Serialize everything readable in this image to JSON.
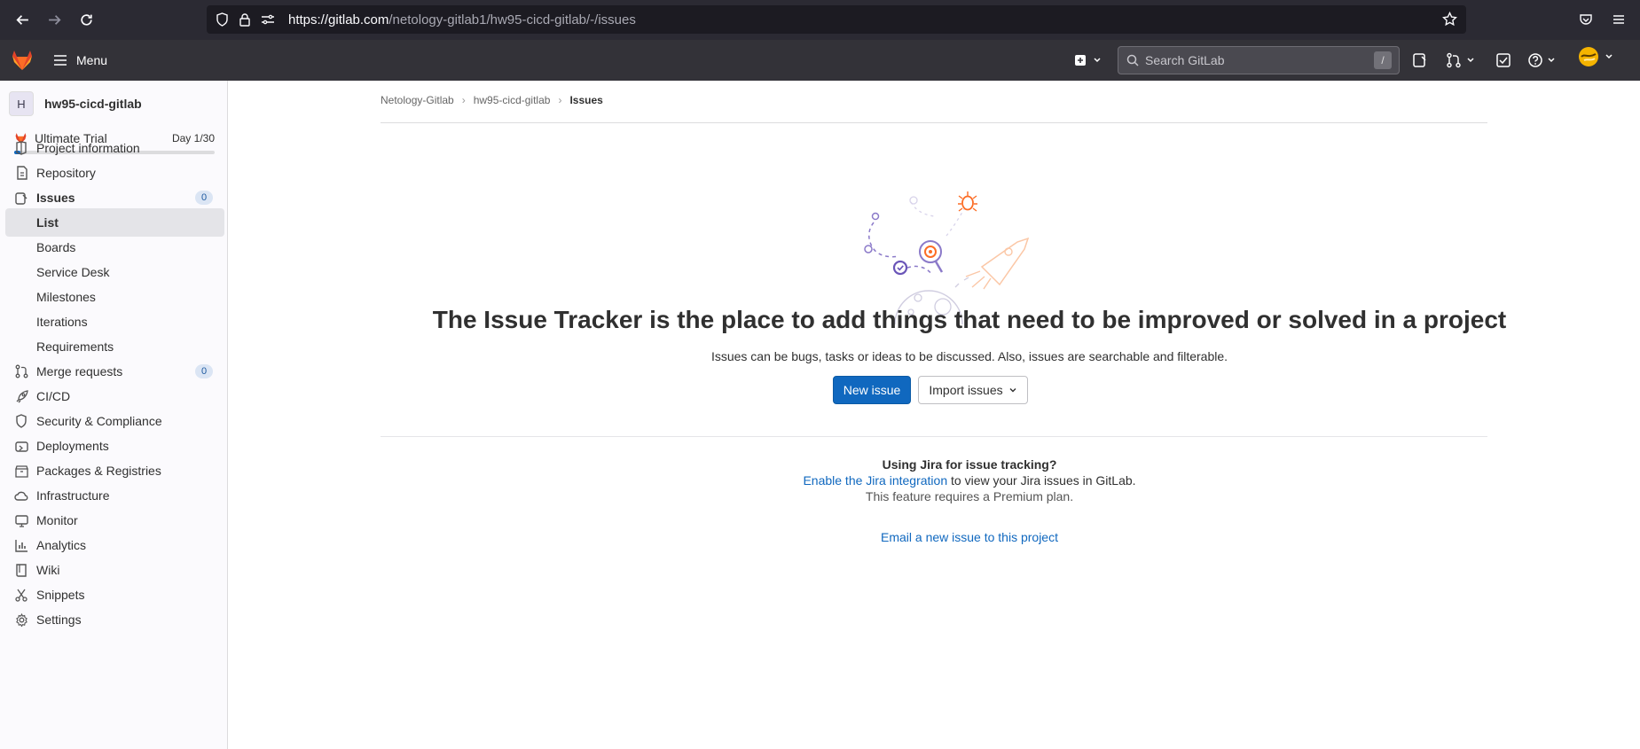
{
  "browser": {
    "url_host": "https://gitlab.com",
    "url_path": "/netology-gitlab1/hw95-cicd-gitlab/-/issues"
  },
  "header": {
    "menu_label": "Menu",
    "search_placeholder": "Search GitLab",
    "search_shortcut": "/"
  },
  "sidebar": {
    "project_avatar": "H",
    "project_name": "hw95-cicd-gitlab",
    "trial_label": "Ultimate Trial",
    "trial_day": "Day 1/30",
    "trial_progress": 0.033,
    "items": [
      {
        "label": "Project information",
        "icon": "project-info-icon"
      },
      {
        "label": "Repository",
        "icon": "repository-icon"
      },
      {
        "label": "Issues",
        "icon": "issues-icon",
        "count": "0"
      },
      {
        "label": "List"
      },
      {
        "label": "Boards"
      },
      {
        "label": "Service Desk"
      },
      {
        "label": "Milestones"
      },
      {
        "label": "Iterations"
      },
      {
        "label": "Requirements"
      },
      {
        "label": "Merge requests",
        "icon": "merge-request-icon",
        "count": "0"
      },
      {
        "label": "CI/CD",
        "icon": "rocket-icon"
      },
      {
        "label": "Security & Compliance",
        "icon": "shield-icon"
      },
      {
        "label": "Deployments",
        "icon": "deployments-icon"
      },
      {
        "label": "Packages & Registries",
        "icon": "package-icon"
      },
      {
        "label": "Infrastructure",
        "icon": "cloud-icon"
      },
      {
        "label": "Monitor",
        "icon": "monitor-icon"
      },
      {
        "label": "Analytics",
        "icon": "chart-icon"
      },
      {
        "label": "Wiki",
        "icon": "book-icon"
      },
      {
        "label": "Snippets",
        "icon": "scissors-icon"
      },
      {
        "label": "Settings",
        "icon": "gear-icon"
      }
    ]
  },
  "breadcrumb": [
    "Netology-Gitlab",
    "hw95-cicd-gitlab",
    "Issues"
  ],
  "empty_state": {
    "title": "The Issue Tracker is the place to add things that need to be improved or solved in a project",
    "description": "Issues can be bugs, tasks or ideas to be discussed. Also, issues are searchable and filterable.",
    "new_issue_label": "New issue",
    "import_issues_label": "Import issues"
  },
  "jira": {
    "heading": "Using Jira for issue tracking?",
    "link_text": "Enable the Jira integration",
    "rest_text": " to view your Jira issues in GitLab.",
    "premium_note": "This feature requires a Premium plan."
  },
  "email_link": "Email a new issue to this project",
  "colors": {
    "header_bg": "#333238",
    "primary": "#1068bf",
    "sidebar_bg": "#fbfafd"
  }
}
